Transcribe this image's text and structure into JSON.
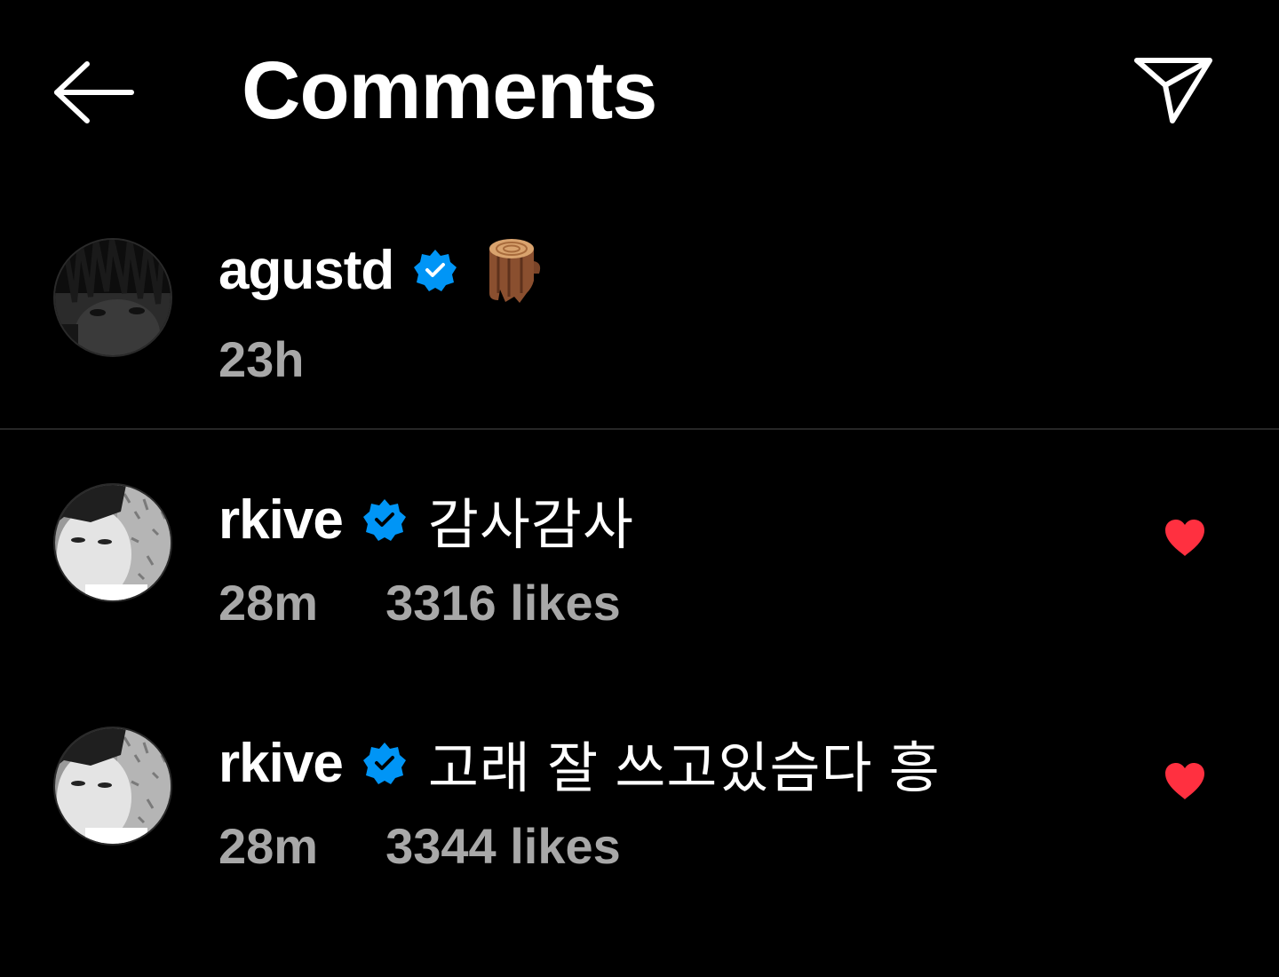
{
  "header": {
    "title": "Comments",
    "back_icon": "arrow-left-icon",
    "send_icon": "paper-plane-icon"
  },
  "caption": {
    "username": "agustd",
    "verified": true,
    "emoji": "wood-log-emoji",
    "time": "23h"
  },
  "comments": [
    {
      "username": "rkive",
      "verified": true,
      "text": "감사감사",
      "time": "28m",
      "likes": "3316 likes",
      "liked": true
    },
    {
      "username": "rkive",
      "verified": true,
      "text": "고래 잘 쓰고있슴다 흥",
      "time": "28m",
      "likes": "3344 likes",
      "liked": true
    }
  ],
  "colors": {
    "background": "#000000",
    "text": "#ffffff",
    "secondary_text": "#a8a8a8",
    "verified_blue": "#0095f6",
    "heart_red": "#ff3040",
    "divider": "#262626"
  }
}
